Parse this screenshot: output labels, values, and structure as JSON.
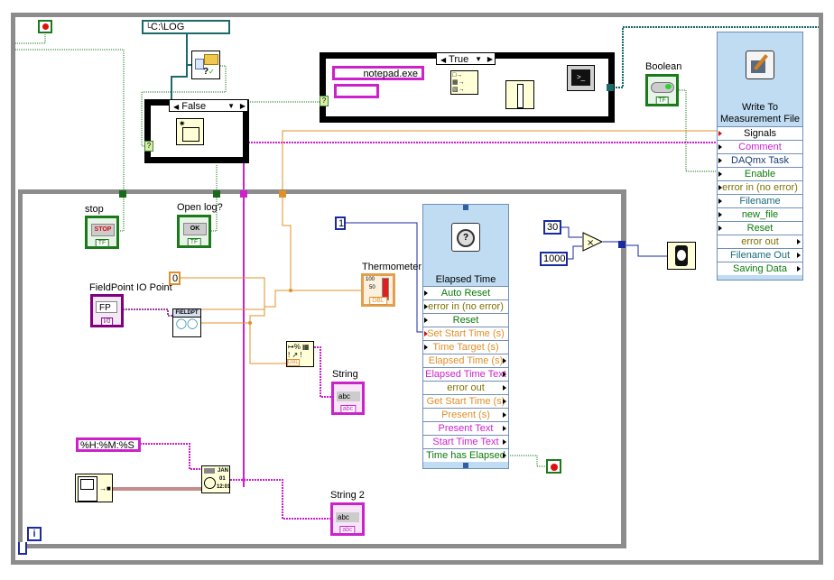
{
  "diagram": {
    "outer_case_false": {
      "selector": "False"
    },
    "inner_case_true": {
      "selector": "True"
    },
    "constants": {
      "log_path": "C:\\LOG",
      "program": "notepad.exe",
      "empty_string": "",
      "zero": "0",
      "one": "1",
      "thirty": "30",
      "thousand": "1000",
      "time_format": "%H:%M:%S"
    },
    "controls": {
      "stop": {
        "label": "stop",
        "button_text": "STOP",
        "type": "TF"
      },
      "open_log": {
        "label": "Open log?",
        "button_text": "OK",
        "type": "TF"
      },
      "boolean": {
        "label": "Boolean",
        "type": "TF"
      },
      "fieldpoint": {
        "label": "FieldPoint IO Point",
        "value": "FP",
        "type": "I/0"
      }
    },
    "indicators": {
      "thermometer": {
        "label": "Thermometer",
        "type": "DBL",
        "scale_top": "100",
        "scale_mid": "50"
      },
      "string": {
        "label": "String",
        "value": "abc",
        "type": "abc"
      },
      "string2": {
        "label": "String 2",
        "value": "abc",
        "type": "abc"
      }
    },
    "nodes": {
      "fieldpoint_read": {
        "header": "FIELDPT"
      },
      "format_value": {
        "type": "DBL"
      },
      "format_date": {
        "month": "JAN",
        "day": "01",
        "time": "12:01"
      }
    },
    "iteration_terminal": "i",
    "elapsed_time": {
      "title": "Elapsed Time",
      "rows": [
        {
          "label": "Auto Reset"
        },
        {
          "label": "error in (no error)"
        },
        {
          "label": "Reset"
        },
        {
          "label": "Set Start Time (s)"
        },
        {
          "label": "Time Target (s)"
        },
        {
          "label": "Elapsed Time (s)"
        },
        {
          "label": "Elapsed Time Text"
        },
        {
          "label": "error out"
        },
        {
          "label": "Get Start Time (s)"
        },
        {
          "label": "Present (s)"
        },
        {
          "label": "Present Text"
        },
        {
          "label": "Start Time Text"
        },
        {
          "label": "Time has Elapsed"
        }
      ]
    },
    "write_file": {
      "title_line1": "Write To",
      "title_line2": "Measurement File",
      "rows": [
        {
          "label": "Signals"
        },
        {
          "label": "Comment"
        },
        {
          "label": "DAQmx Task"
        },
        {
          "label": "Enable"
        },
        {
          "label": "error in (no error)"
        },
        {
          "label": "Filename"
        },
        {
          "label": "new_file"
        },
        {
          "label": "Reset"
        },
        {
          "label": "error out"
        },
        {
          "label": "Filename Out"
        },
        {
          "label": "Saving Data"
        }
      ]
    },
    "colors": {
      "loop_border": "#8c8c8c",
      "boolean_wire": "#0a7a0a",
      "string_wire": "#cc22cc",
      "dbl_wire": "#e0902a",
      "int_wire": "#1a2aa0",
      "path_wire": "#1a6a6a",
      "express_bg": "#bfdcf3"
    }
  }
}
